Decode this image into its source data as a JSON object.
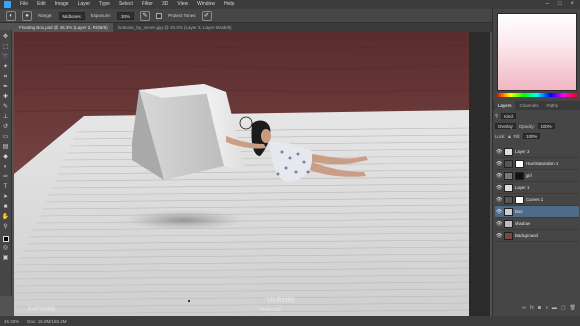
{
  "menubar": {
    "items": [
      "File",
      "Edit",
      "Image",
      "Layer",
      "Type",
      "Select",
      "Filter",
      "3D",
      "View",
      "Window",
      "Help"
    ]
  },
  "options": {
    "range_label": "Range:",
    "range_value": "Midtones",
    "exposure_label": "Exposure:",
    "exposure_value": "30%",
    "protect_label": "Protect Tones"
  },
  "document": {
    "tab_title": "Floating Box.psd @ 45.3% (Layer 2, RGB/8)",
    "tab_title_2": "footnote_by_seven.jpg @ 45.3% (Layer 3, Layer Mask/8)"
  },
  "status": {
    "zoom": "45.33%",
    "doc": "Doc: 15.0M/160.4M"
  },
  "panels": {
    "tabs": [
      "Layers",
      "Channels",
      "Paths"
    ],
    "kind_label": "Kind",
    "blend_mode": "Overlay",
    "opacity_label": "Opacity:",
    "opacity_value": "100%",
    "lock_label": "Lock:",
    "fill_label": "Fill:",
    "fill_value": "100%",
    "layers": [
      {
        "name": "Layer 3",
        "selected": false,
        "mask": false
      },
      {
        "name": "Hue/Saturation 1",
        "selected": false,
        "mask": true
      },
      {
        "name": "girl",
        "selected": false,
        "mask": true
      },
      {
        "name": "Layer 1",
        "selected": false,
        "mask": false
      },
      {
        "name": "Curves 1",
        "selected": false,
        "mask": true
      },
      {
        "name": "Box",
        "selected": true,
        "mask": false
      },
      {
        "name": "shadow",
        "selected": false,
        "mask": false
      },
      {
        "name": "Background",
        "selected": false,
        "mask": false
      }
    ]
  },
  "watermarks": {
    "left": "KAFVARB",
    "center": "飞特素材网",
    "center2": "fevte.com"
  },
  "colors": {
    "accent": "#4f6b8a",
    "wood": "#6b3a3a",
    "paper": "#e2e2e2"
  }
}
